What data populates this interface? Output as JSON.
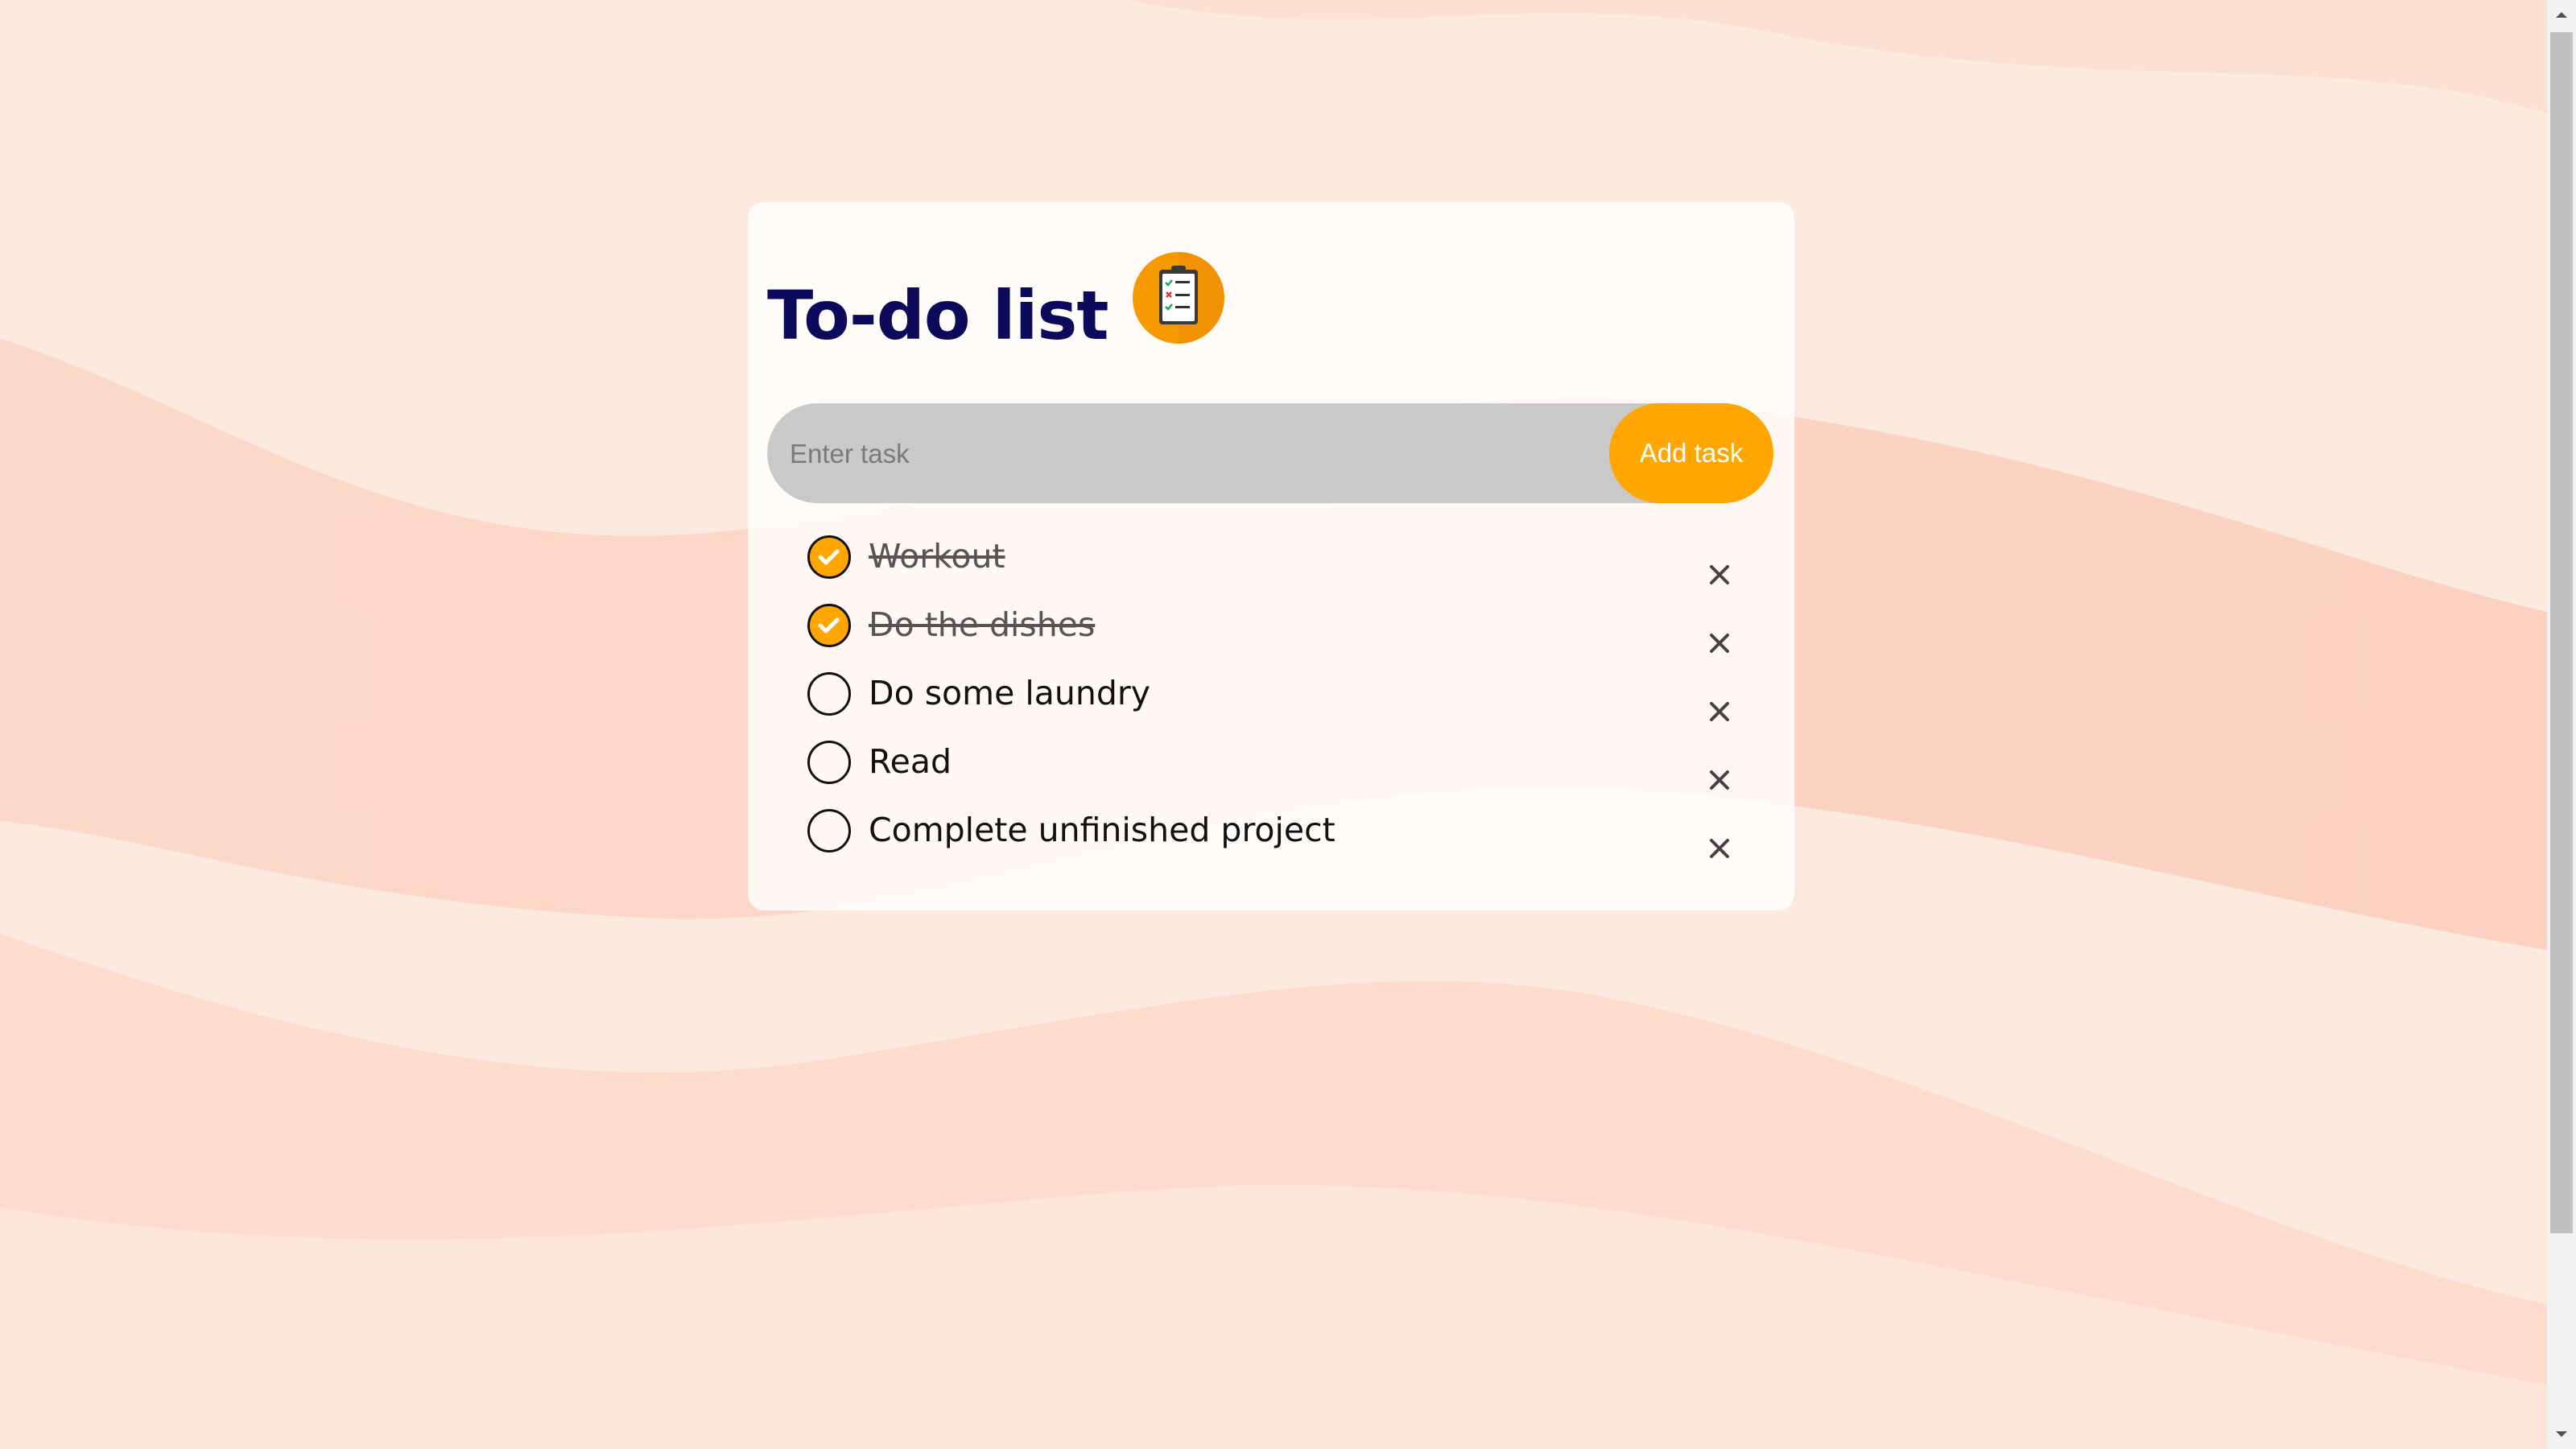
{
  "app": {
    "title": "To-do list",
    "logo_icon": "clipboard-checklist-icon"
  },
  "input": {
    "placeholder": "Enter task",
    "value": ""
  },
  "add_button": {
    "label": "Add task"
  },
  "tasks": [
    {
      "text": "Workout",
      "done": true
    },
    {
      "text": "Do the dishes",
      "done": true
    },
    {
      "text": "Do some laundry",
      "done": false
    },
    {
      "text": "Read",
      "done": false
    },
    {
      "text": "Complete unfinished project",
      "done": false
    }
  ],
  "colors": {
    "accent": "#ffa600",
    "title": "#0c0a5a",
    "input_bg": "#c9c9c9",
    "background": "#fde9dd"
  },
  "icons": {
    "check": "check-icon",
    "remove": "close-icon"
  }
}
